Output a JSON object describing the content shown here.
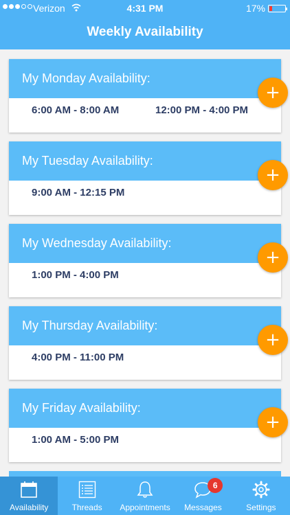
{
  "status_bar": {
    "carrier": "Verizon",
    "time": "4:31 PM",
    "battery": "17%"
  },
  "header": {
    "title": "Weekly Availability"
  },
  "days": [
    {
      "title": "My Monday Availability:",
      "slots": [
        "6:00 AM - 8:00 AM",
        "12:00 PM - 4:00 PM"
      ]
    },
    {
      "title": "My Tuesday Availability:",
      "slots": [
        "9:00 AM - 12:15 PM"
      ]
    },
    {
      "title": "My Wednesday Availability:",
      "slots": [
        "1:00 PM - 4:00 PM"
      ]
    },
    {
      "title": "My Thursday Availability:",
      "slots": [
        "4:00 PM - 11:00 PM"
      ]
    },
    {
      "title": "My Friday Availability:",
      "slots": [
        "1:00 AM - 5:00 PM"
      ]
    }
  ],
  "add_button": {
    "symbol": "+"
  },
  "tabs": [
    {
      "label": "Availability",
      "icon": "calendar-icon",
      "active": true
    },
    {
      "label": "Threads",
      "icon": "list-icon"
    },
    {
      "label": "Appointments",
      "icon": "bell-icon"
    },
    {
      "label": "Messages",
      "icon": "chat-icon",
      "badge": "6"
    },
    {
      "label": "Settings",
      "icon": "gear-icon"
    }
  ],
  "colors": {
    "header": "#4fb3f6",
    "card_header": "#5bbcf8",
    "add_button": "#ff9a00",
    "slot_text": "#2d3d64",
    "badge": "#e5372e"
  }
}
